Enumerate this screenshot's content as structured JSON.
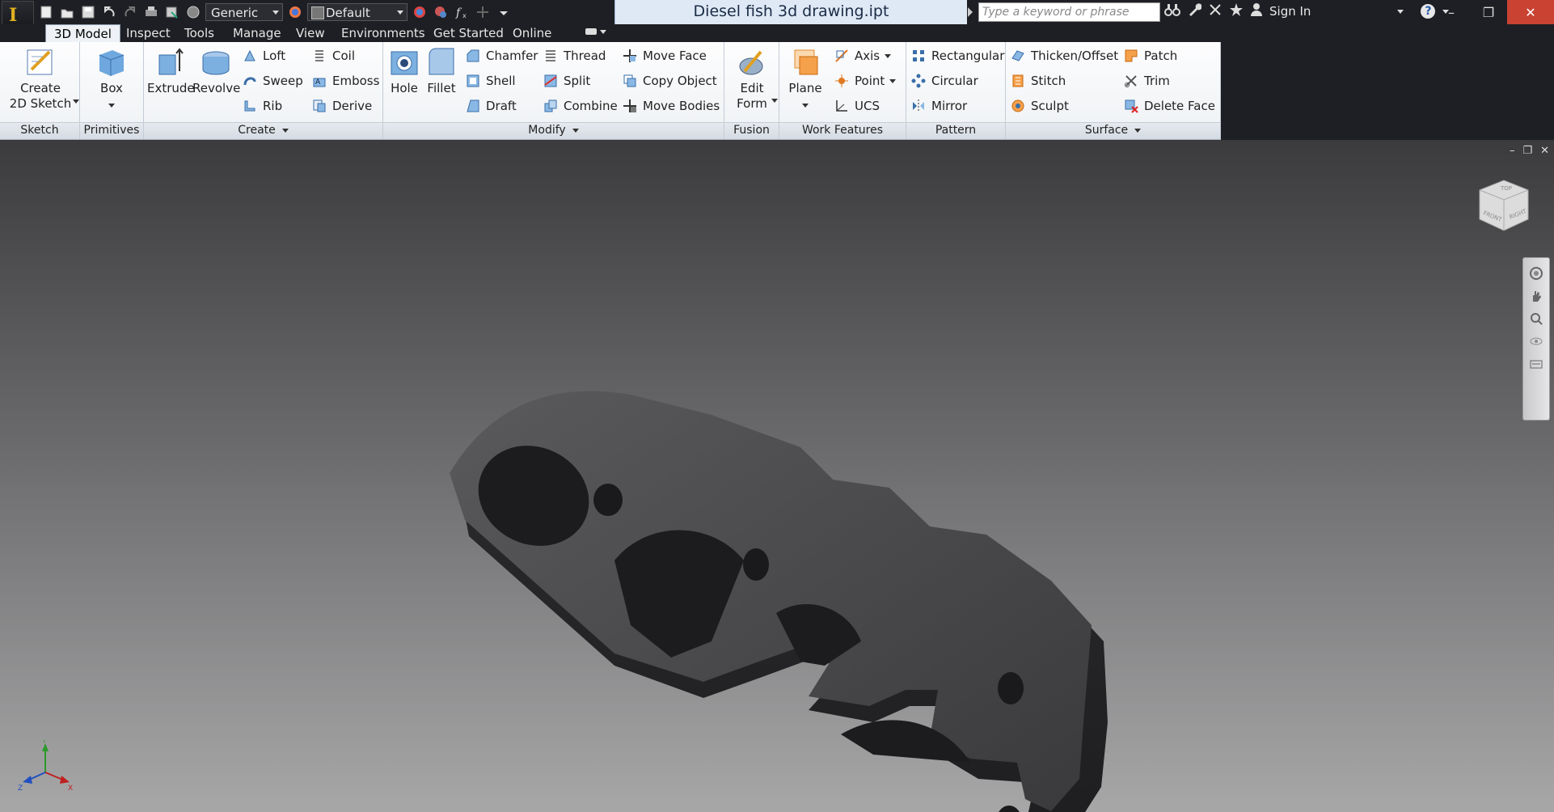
{
  "app": {
    "logo_letter": "I"
  },
  "quick_access": {
    "material_value": "Generic",
    "appearance_value": "Default"
  },
  "window": {
    "title": "Diesel fish 3d drawing.ipt"
  },
  "search": {
    "placeholder": "Type a keyword or phrase"
  },
  "account": {
    "sign_in": "Sign In",
    "help": "?"
  },
  "tabs": [
    "3D Model",
    "Inspect",
    "Tools",
    "Manage",
    "View",
    "Environments",
    "Get Started",
    "Online"
  ],
  "ribbon": {
    "sketch": {
      "label": "Sketch",
      "create_line1": "Create",
      "create_line2": "2D Sketch"
    },
    "primitives": {
      "label": "Primitives",
      "box": "Box"
    },
    "create": {
      "label": "Create",
      "extrude": "Extrude",
      "revolve": "Revolve",
      "loft": "Loft",
      "sweep": "Sweep",
      "rib": "Rib",
      "coil": "Coil",
      "emboss": "Emboss",
      "derive": "Derive"
    },
    "modify": {
      "label": "Modify",
      "hole": "Hole",
      "fillet": "Fillet",
      "chamfer": "Chamfer",
      "shell": "Shell",
      "draft": "Draft",
      "thread": "Thread",
      "split": "Split",
      "combine": "Combine",
      "move_face": "Move Face",
      "copy_object": "Copy Object",
      "move_bodies": "Move Bodies"
    },
    "fusion": {
      "label": "Fusion",
      "edit_line1": "Edit",
      "edit_line2": "Form"
    },
    "work_features": {
      "label": "Work Features",
      "plane": "Plane",
      "axis": "Axis",
      "point": "Point",
      "ucs": "UCS"
    },
    "pattern": {
      "label": "Pattern",
      "rectangular": "Rectangular",
      "circular": "Circular",
      "mirror": "Mirror"
    },
    "surface": {
      "label": "Surface",
      "thicken": "Thicken/Offset",
      "stitch": "Stitch",
      "sculpt": "Sculpt",
      "patch": "Patch",
      "trim": "Trim",
      "delete_face": "Delete Face"
    }
  },
  "viewcube": {
    "top": "TOP",
    "front": "FRONT",
    "right": "RIGHT"
  },
  "triad": {
    "x": "X",
    "y": "Y",
    "z": "Z"
  },
  "colors": {
    "accent": "#dfe9f6",
    "close": "#c94232",
    "model": "#4a4a4c"
  }
}
